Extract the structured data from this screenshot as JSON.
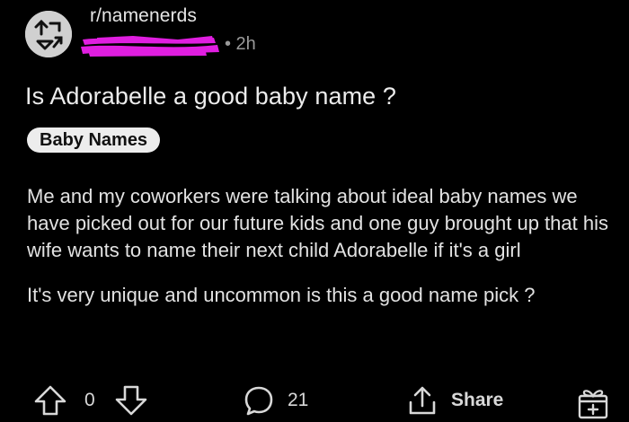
{
  "post": {
    "subreddit": "r/namenerds",
    "timestamp": "• 2h",
    "title": "Is Adorabelle a good baby name ?",
    "flair": "Baby Names",
    "body": [
      "Me and my coworkers were talking about ideal baby names we have picked out for our future kids and one guy brought up that his wife wants to name their next child Adorabelle if it's a girl",
      "It's very unique and uncommon is this a good name pick ?"
    ]
  },
  "actions": {
    "vote_count": "0",
    "comment_count": "21",
    "share_label": "Share"
  },
  "icons": {
    "avatar": "subreddit-avatar-icon",
    "upvote": "upvote-arrow-icon",
    "downvote": "downvote-arrow-icon",
    "comment": "comment-bubble-icon",
    "share": "share-icon",
    "award": "gift-award-icon"
  },
  "colors": {
    "background": "#000000",
    "text": "#e8e8e8",
    "muted": "#9a9a9a",
    "flair_bg": "#ededed",
    "redaction": "#e01ee0"
  }
}
